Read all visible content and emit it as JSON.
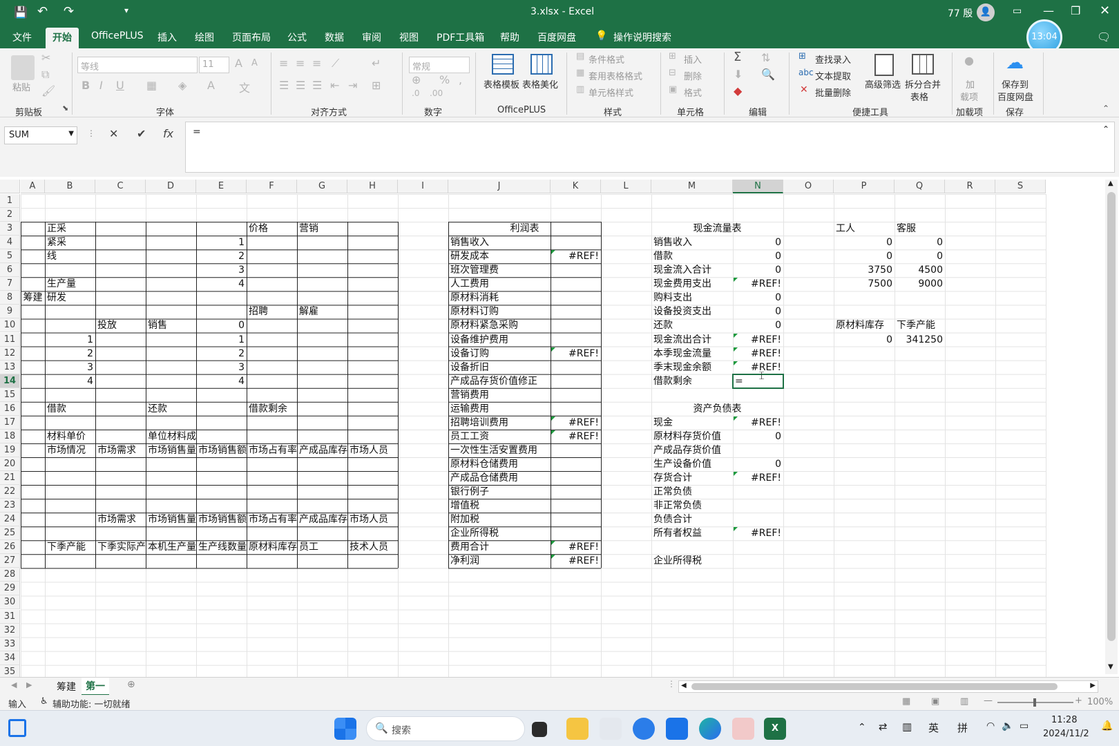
{
  "titlebar": {
    "filename": "3.xlsx",
    "separator": "-",
    "app_name": "Excel",
    "user": "77 殷",
    "clock_badge": "13:04"
  },
  "ribbon_tabs": [
    "文件",
    "开始",
    "OfficePLUS",
    "插入",
    "绘图",
    "页面布局",
    "公式",
    "数据",
    "审阅",
    "视图",
    "PDF工具箱",
    "帮助",
    "百度网盘"
  ],
  "search_hint": "操作说明搜索",
  "ribbon": {
    "clipboard": {
      "paste": "粘贴",
      "label": "剪贴板"
    },
    "font": {
      "name": "等线",
      "size": "11",
      "label": "字体"
    },
    "alignment": {
      "label": "对齐方式"
    },
    "number": {
      "format": "常规",
      "label": "数字"
    },
    "officeplus": {
      "template": "表格模板",
      "beautify": "表格美化",
      "label": "OfficePLUS"
    },
    "styles": {
      "conditional": "条件格式",
      "table_format": "套用表格格式",
      "cell_style": "单元格样式",
      "label": "样式"
    },
    "cells": {
      "insert": "插入",
      "delete": "删除",
      "format": "格式",
      "label": "单元格"
    },
    "editing": {
      "label": "编辑"
    },
    "quick_tools": {
      "find": "查找录入",
      "text_extract": "文本提取",
      "batch_delete": "批量删除",
      "advanced_filter": "高级筛选",
      "split_merge_1": "拆分合并",
      "split_merge_2": "表格",
      "label": "便捷工具"
    },
    "addins": {
      "load_1": "加",
      "load_2": "载项",
      "label": "加载项"
    },
    "save": {
      "save_1": "保存到",
      "save_2": "百度网盘",
      "label": "保存"
    }
  },
  "formula_bar": {
    "name_box": "SUM",
    "content": "="
  },
  "columns": [
    "A",
    "B",
    "C",
    "D",
    "E",
    "F",
    "G",
    "H",
    "I",
    "J",
    "K",
    "L",
    "M",
    "N",
    "O",
    "P",
    "Q",
    "R",
    "S"
  ],
  "rows": [
    "1",
    "2",
    "3",
    "4",
    "5",
    "6",
    "7",
    "8",
    "9",
    "10",
    "11",
    "12",
    "13",
    "14",
    "15",
    "16",
    "17",
    "18",
    "19",
    "20",
    "21",
    "22",
    "23",
    "24",
    "25",
    "26",
    "27",
    "28",
    "29",
    "30",
    "31",
    "32",
    "33",
    "34",
    "35"
  ],
  "cells": {
    "A8": "筹建",
    "B3": "正采",
    "B4": "紧采",
    "B5": "线",
    "B7": "生产量",
    "B8": "研发",
    "E4": "1",
    "E5": "2",
    "E6": "3",
    "E7": "4",
    "F3": "价格",
    "G3": "营销",
    "F9": "招聘",
    "G9": "解雇",
    "C10": "投放",
    "D10": "销售",
    "E10": "0",
    "B11": "1",
    "E11": "1",
    "B12": "2",
    "E12": "2",
    "B13": "3",
    "E13": "3",
    "B14": "4",
    "E14": "4",
    "B16": "借款",
    "D16": "还款",
    "F16": "借款剩余",
    "B18": "材料单价",
    "D18": "单位材料成本",
    "B19": "市场情况",
    "C19": "市场需求",
    "D19": "市场销售量",
    "E19": "市场销售额",
    "F19": "市场占有率",
    "G19": "产成品库存",
    "H19": "市场人员",
    "C24": "市场需求",
    "D24": "市场销售量",
    "E24": "市场销售额",
    "F24": "市场占有率",
    "G24": "产成品库存",
    "H24": "市场人员",
    "B26": "下季产能",
    "C26": "下季实际产能",
    "D26": "本机生产量",
    "E26": "生产线数量",
    "F26": "原材料库存",
    "G26": "员工",
    "H26": "技术人员",
    "J3": "利润表",
    "J4": "销售收入",
    "J5": "研发成本",
    "K5": "#REF!",
    "J6": "班次管理费",
    "J7": "人工费用",
    "J8": "原材料消耗",
    "J9": "原材料订购",
    "J10": "原材料紧急采购",
    "J11": "设备维护费用",
    "J12": "设备订购",
    "K12": "#REF!",
    "J13": "设备折旧",
    "J14": "产成品存货价值修正",
    "J15": "营销费用",
    "J16": "运输费用",
    "J17": "招聘培训费用",
    "K17": "#REF!",
    "J18": "员工工资",
    "K18": "#REF!",
    "J19": "一次性生活安置费用",
    "J20": "原材料仓储费用",
    "J21": "产成品仓储费用",
    "J22": "银行例子",
    "J23": "增值税",
    "J24": "附加税",
    "J25": "企业所得税",
    "J26": "费用合计",
    "K26": "#REF!",
    "J27": "净利润",
    "K27": "#REF!",
    "M3": "现金流量表",
    "M4": "销售收入",
    "N4": "0",
    "M5": "借款",
    "N5": "0",
    "M6": "现金流入合计",
    "N6": "0",
    "M7": "现金费用支出",
    "N7": "#REF!",
    "M8": "购料支出",
    "N8": "0",
    "M9": "设备投资支出",
    "N9": "0",
    "M10": "还款",
    "N10": "0",
    "M11": "现金流出合计",
    "N11": "#REF!",
    "M12": "本季现金流量",
    "N12": "#REF!",
    "M13": "季末现金余额",
    "N13": "#REF!",
    "M14": "借款剩余",
    "N14": "=",
    "M16": "资产负债表",
    "M17": "现金",
    "N17": "#REF!",
    "M18": "原材料存货价值",
    "N18": "0",
    "M19": "产成品存货价值",
    "M20": "生产设备价值",
    "N20": "0",
    "M21": "存货合计",
    "N21": "#REF!",
    "M22": "正常负债",
    "M23": "非正常负债",
    "M24": "负债合计",
    "M25": "所有者权益",
    "N25": "#REF!",
    "M27": "企业所得税",
    "P3": "工人",
    "Q3": "客服",
    "P4": "0",
    "Q4": "0",
    "P5": "0",
    "Q5": "0",
    "P6": "3750",
    "Q6": "4500",
    "P7": "7500",
    "Q7": "9000",
    "P10": "原材料库存",
    "Q10": "下季产能",
    "P11": "0",
    "Q11": "341250"
  },
  "selected_cell": {
    "col": "N",
    "row": "14"
  },
  "sheet_tabs": [
    "筹建",
    "第一"
  ],
  "active_sheet": "第一",
  "status": {
    "mode": "输入",
    "accessibility": "辅助功能: 一切就绪",
    "zoom": "100%"
  },
  "taskbar": {
    "search_placeholder": "搜索",
    "lang_1": "英",
    "lang_2": "拼",
    "time": "11:28",
    "date": "2024/11/2"
  },
  "colors": {
    "excel_green": "#1e7145",
    "error_flag": "#1e9a3e"
  }
}
